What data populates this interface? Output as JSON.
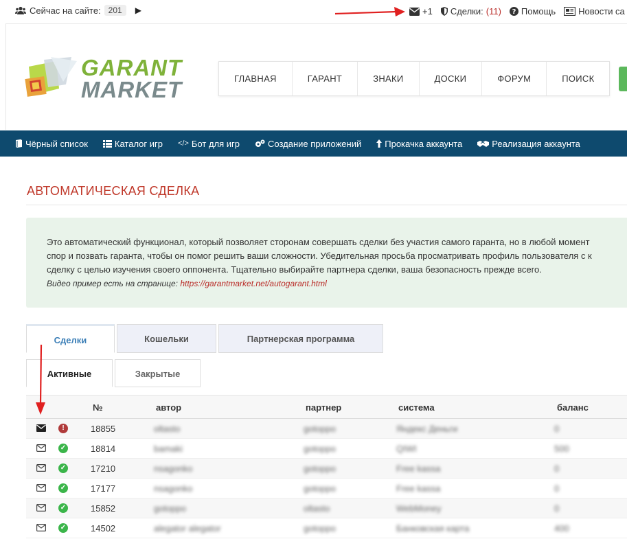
{
  "topbar": {
    "online_label": "Сейчас на сайте:",
    "online_count": "201",
    "messages_count": "+1",
    "deals_label": "Сделки:",
    "deals_count": "(11)",
    "help_label": "Помощь",
    "news_label": "Новости са"
  },
  "logo": {
    "line1": "GARANT",
    "line2": "MARKET"
  },
  "mainnav": [
    "ГЛАВНАЯ",
    "ГАРАНТ",
    "ЗНАКИ",
    "ДОСКИ",
    "ФОРУМ",
    "ПОИСК"
  ],
  "bluemenu": [
    {
      "icon": "book-icon",
      "label": "Чёрный список"
    },
    {
      "icon": "list-icon",
      "label": "Каталог игр"
    },
    {
      "icon": "code-icon",
      "label": "Бот для игр"
    },
    {
      "icon": "gears-icon",
      "label": "Создание приложений"
    },
    {
      "icon": "arrow-up-icon",
      "label": "Прокачка аккаунта"
    },
    {
      "icon": "handshake-icon",
      "label": "Реализация аккаунта"
    }
  ],
  "page": {
    "title": "АВТОМАТИЧЕСКАЯ СДЕЛКА",
    "notice_line1": "Это автоматический функционал, который позволяет сторонам совершать сделки без участия самого гаранта, но в любой момент",
    "notice_line2": "спор и позвать гаранта, чтобы он помог решить ваши сложности. Убедительная просьба просматривать профиль пользователя с к",
    "notice_line3": "сделку с целью изучения своего оппонента. Тщательно выбирайте партнера сделки, ваша безопасность прежде всего.",
    "video_label": "Видео пример есть на странице:",
    "video_link": "https://garantmarket.net/autogarant.html"
  },
  "tabs": [
    "Сделки",
    "Кошельки",
    "Партнерская программа"
  ],
  "subtabs": [
    "Активные",
    "Закрытые"
  ],
  "table": {
    "headers": {
      "num": "№",
      "author": "автор",
      "partner": "партнер",
      "system": "система",
      "balance": "баланс"
    },
    "rows": [
      {
        "msg": "filled",
        "status": "warn",
        "num": "18855",
        "author": "oltasto",
        "partner": "gotoppo",
        "system": "Яндекс Деньги",
        "balance": "0"
      },
      {
        "msg": "outline",
        "status": "ok",
        "num": "18814",
        "author": "bamaki",
        "partner": "gotoppo",
        "system": "QIWI",
        "balance": "500"
      },
      {
        "msg": "outline",
        "status": "ok",
        "num": "17210",
        "author": "nsagonko",
        "partner": "gotoppo",
        "system": "Free kassa",
        "balance": "0"
      },
      {
        "msg": "outline",
        "status": "ok",
        "num": "17177",
        "author": "nsagonko",
        "partner": "gotoppo",
        "system": "Free kassa",
        "balance": "0"
      },
      {
        "msg": "outline",
        "status": "ok",
        "num": "15852",
        "author": "gotoppo",
        "partner": "oltasto",
        "system": "WebMoney",
        "balance": "0"
      },
      {
        "msg": "outline",
        "status": "ok",
        "num": "14502",
        "author": "alegator alegator",
        "partner": "gotoppo",
        "system": "Банковская карта",
        "balance": "400"
      }
    ]
  },
  "colors": {
    "accent": "#c0392b",
    "bluebar": "#0e4a6e",
    "ok": "#3bb54a",
    "warn": "#b03a3a",
    "arrow": "#e02020"
  }
}
